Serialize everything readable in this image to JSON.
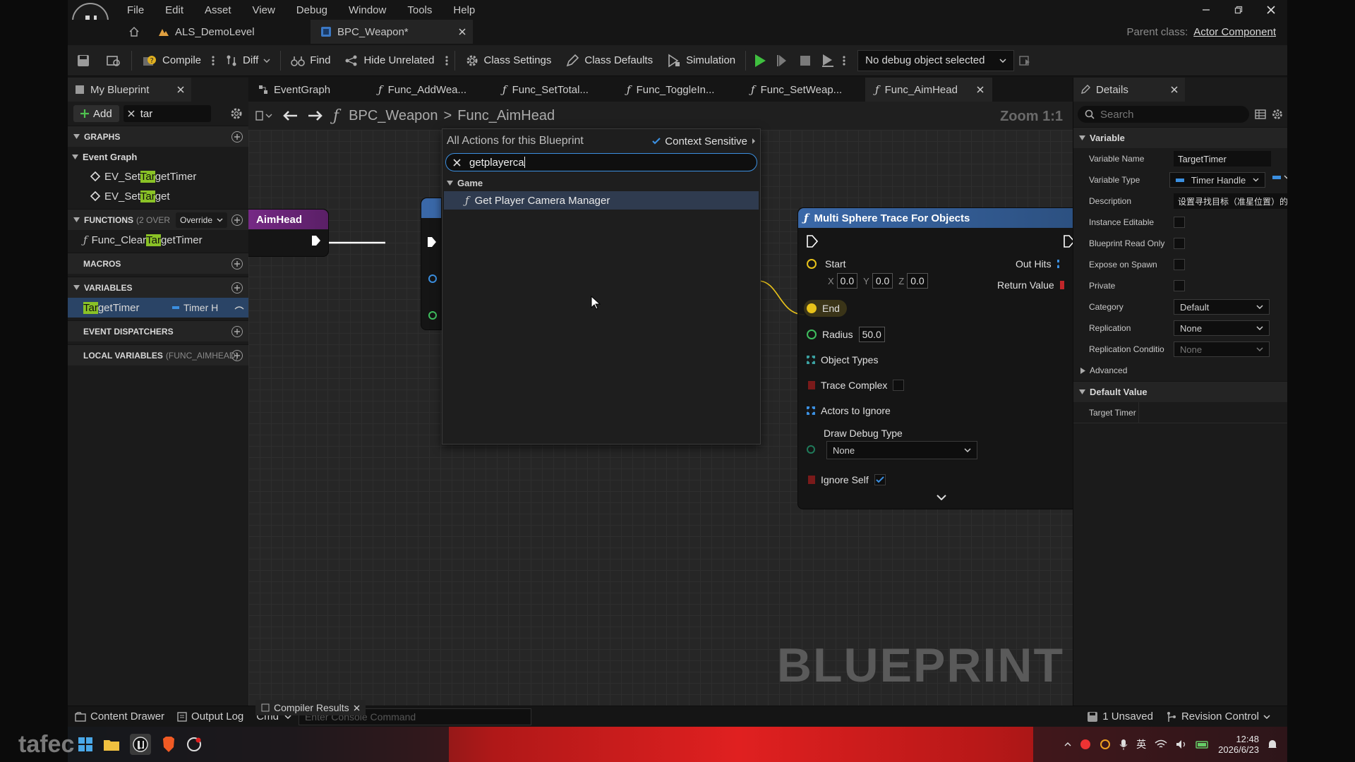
{
  "menu": [
    "File",
    "Edit",
    "Asset",
    "View",
    "Debug",
    "Window",
    "Tools",
    "Help"
  ],
  "doc_tabs": [
    {
      "label": "ALS_DemoLevel"
    },
    {
      "label": "BPC_Weapon*"
    }
  ],
  "parent_class": {
    "label": "Parent class:",
    "value": "Actor Component"
  },
  "toolbar": {
    "compile": "Compile",
    "diff": "Diff",
    "find": "Find",
    "hide_unrelated": "Hide Unrelated",
    "class_settings": "Class Settings",
    "class_defaults": "Class Defaults",
    "simulation": "Simulation",
    "debug_object": "No debug object selected"
  },
  "my_blueprint": {
    "tab": "My Blueprint",
    "add": "Add",
    "search_value": "tar",
    "graphs_hdr": "GRAPHS",
    "event_graph": "Event Graph",
    "events": [
      {
        "pre": "EV_Set",
        "hl": "Tar",
        "post": "getTimer"
      },
      {
        "pre": "EV_Set",
        "hl": "Tar",
        "post": "get"
      }
    ],
    "functions_hdr": "FUNCTIONS",
    "functions_count": "(2 OVER",
    "override": "Override",
    "functions": [
      {
        "pre": "Func_Clear",
        "hl": "Tar",
        "post": "getTimer"
      }
    ],
    "macros_hdr": "MACROS",
    "variables_hdr": "VARIABLES",
    "variables": [
      {
        "hl": "Tar",
        "post": "getTimer",
        "type": "Timer H"
      }
    ],
    "dispatchers_hdr": "EVENT DISPATCHERS",
    "local_vars_hdr": "LOCAL VARIABLES",
    "local_vars_scope": "(FUNC_AIMHEAD)"
  },
  "graph_tabs": [
    "EventGraph",
    "Func_AddWea...",
    "Func_SetTotal...",
    "Func_ToggleIn...",
    "Func_SetWeap...",
    "Func_AimHead"
  ],
  "breadcrumb": {
    "root": "BPC_Weapon",
    "sep": ">",
    "current": "Func_AimHead"
  },
  "zoom": "Zoom 1:1",
  "watermark": "BLUEPRINT",
  "entry_node": {
    "title": "AimHead"
  },
  "trace_node": {
    "title": "Multi Sphere Trace For Objects",
    "start": "Start",
    "start_x": "0.0",
    "start_y": "0.0",
    "start_z": "0.0",
    "x": "X",
    "y": "Y",
    "z": "Z",
    "out_hits": "Out Hits",
    "return_value": "Return Value",
    "end": "End",
    "radius": "Radius",
    "radius_value": "50.0",
    "object_types": "Object Types",
    "trace_complex": "Trace Complex",
    "actors_to_ignore": "Actors to Ignore",
    "draw_debug_type": "Draw Debug Type",
    "draw_debug_value": "None",
    "ignore_self": "Ignore Self"
  },
  "action_menu": {
    "title": "All Actions for this Blueprint",
    "context_sensitive": "Context Sensitive",
    "search_value": "getplayerca",
    "category": "Game",
    "result": "Get Player Camera Manager"
  },
  "details": {
    "tab": "Details",
    "search_placeholder": "Search",
    "variable_hdr": "Variable",
    "variable_name_label": "Variable Name",
    "variable_name": "TargetTimer",
    "variable_type_label": "Variable Type",
    "variable_type": "Timer Handle",
    "description_label": "Description",
    "description": "设置寻找目标（准星位置）的定时器",
    "instance_editable": "Instance Editable",
    "bp_read_only": "Blueprint Read Only",
    "expose_on_spawn": "Expose on Spawn",
    "private": "Private",
    "category_label": "Category",
    "category": "Default",
    "replication_label": "Replication",
    "replication": "None",
    "replication_cond_label": "Replication Conditio",
    "replication_cond": "None",
    "advanced": "Advanced",
    "default_value_hdr": "Default Value",
    "target_timer": "Target Timer"
  },
  "statusbar": {
    "content_drawer": "Content Drawer",
    "output_log": "Output Log",
    "cmd": "Cmd",
    "console_placeholder": "Enter Console Command",
    "compiler_results": "Compiler Results",
    "unsaved": "1 Unsaved",
    "revision_control": "Revision Control"
  },
  "taskbar": {
    "watermark": "tafec",
    "time": "12:48",
    "date": "2026/6/23",
    "ime": "英"
  },
  "colors": {
    "accent_green": "#8ac226",
    "exec_white": "#ffffff",
    "pin_yellow": "#e8c21a",
    "pin_green": "#3fbf5f",
    "pin_blue": "#3b8fe0",
    "pin_red": "#c0262a",
    "func_header": "#3a68a8",
    "entry_header": "#7a2b8a"
  }
}
